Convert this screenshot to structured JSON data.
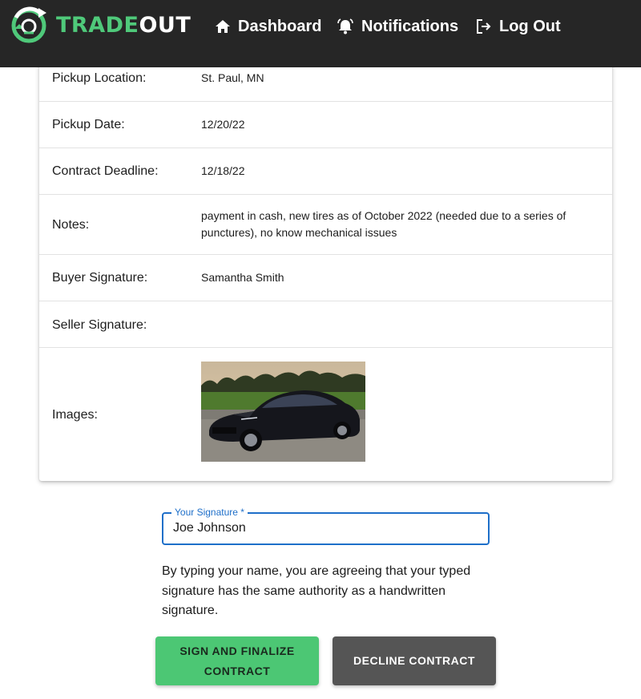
{
  "header": {
    "brand_part1": "TRADE",
    "brand_part2": "OUT",
    "nav": {
      "dashboard": "Dashboard",
      "notifications": "Notifications",
      "logout": "Log Out"
    }
  },
  "contract": {
    "rows": [
      {
        "label": "Pickup Location:",
        "value": "St. Paul, MN"
      },
      {
        "label": "Pickup Date:",
        "value": "12/20/22"
      },
      {
        "label": "Contract Deadline:",
        "value": "12/18/22"
      },
      {
        "label": "Notes:",
        "value": "payment in cash, new tires as of October 2022 (needed due to a series of punctures), no know mechanical issues"
      },
      {
        "label": "Buyer Signature:",
        "value": "Samantha Smith"
      },
      {
        "label": "Seller Signature:",
        "value": ""
      },
      {
        "label": "Images:",
        "value": ""
      }
    ]
  },
  "signature": {
    "label": "Your Signature *",
    "value": "Joe Johnson"
  },
  "disclaimer": "By typing your name, you are agreeing that your typed signature has the same authority as a handwritten signature.",
  "actions": {
    "sign": "Sign and Finalize Contract",
    "decline": "Decline Contract"
  },
  "colors": {
    "accent_green": "#4cc774",
    "header_bg": "#262626",
    "focus_blue": "#1e6fc9",
    "decline_gray": "#555555"
  },
  "icons": {
    "logo": "tradeout-logo-icon",
    "dashboard": "home-icon",
    "notifications": "bell-icon",
    "logout": "logout-icon"
  }
}
